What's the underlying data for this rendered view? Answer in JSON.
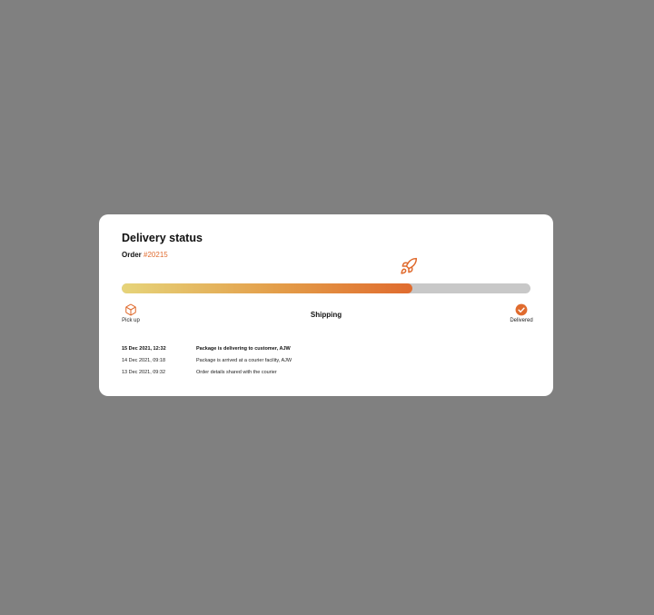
{
  "card": {
    "title": "Delivery status",
    "order_label": "Order",
    "order_number": "#20215"
  },
  "progress": {
    "fraction": 0.71,
    "current_stage": "Shipping",
    "current_stage_icon": "rocket-icon",
    "start_stage": {
      "label": "Pick up",
      "icon": "package-box-icon"
    },
    "end_stage": {
      "label": "Delivered",
      "icon": "check-circle-icon"
    }
  },
  "timeline": [
    {
      "date": "15 Dec 2021, 12:32",
      "event": "Package is delivering to customer, AJW"
    },
    {
      "date": "14 Dec 2021, 09:18",
      "event": "Package is arrived at a courier facility, AJW"
    },
    {
      "date": "13 Dec 2021, 09:32",
      "event": "Order details shared with the courier"
    }
  ],
  "colors": {
    "background": "#808080",
    "card": "#ffffff",
    "accent": "#e06b2e",
    "gradient_start": "#e6d47a",
    "gradient_end": "#e06b2e",
    "track": "#c8c8c8"
  }
}
